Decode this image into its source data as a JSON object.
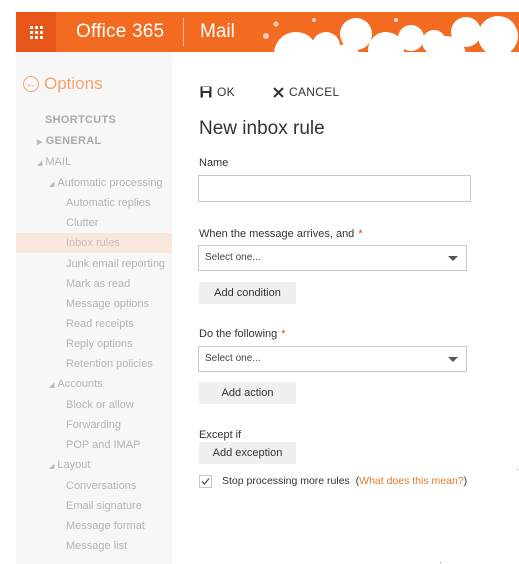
{
  "header": {
    "brand": "Office 365",
    "app": "Mail",
    "colors": {
      "bar": "#f26b21",
      "waffle": "#e8561a"
    }
  },
  "sidebar": {
    "back_label": "Options",
    "items": [
      {
        "label": "SHORTCUTS",
        "type": "section"
      },
      {
        "label": "GENERAL",
        "type": "section"
      },
      {
        "label": "MAIL",
        "type": "section"
      },
      {
        "label": "Automatic processing",
        "type": "group"
      },
      {
        "label": "Automatic replies"
      },
      {
        "label": "Clutter"
      },
      {
        "label": "Inbox rules",
        "active": true
      },
      {
        "label": "Junk email reporting"
      },
      {
        "label": "Mark as read"
      },
      {
        "label": "Message options"
      },
      {
        "label": "Read receipts"
      },
      {
        "label": "Reply options"
      },
      {
        "label": "Retention policies"
      },
      {
        "label": "Accounts",
        "type": "group"
      },
      {
        "label": "Block or allow"
      },
      {
        "label": "Forwarding"
      },
      {
        "label": "POP and IMAP"
      },
      {
        "label": "Layout",
        "type": "group"
      },
      {
        "label": "Conversations"
      },
      {
        "label": "Email signature"
      },
      {
        "label": "Message format"
      },
      {
        "label": "Message list"
      }
    ]
  },
  "commands": {
    "ok": "OK",
    "cancel": "CANCEL"
  },
  "form": {
    "title": "New inbox rule",
    "name_label": "Name",
    "name_value": "",
    "when_label": "When the message arrives, and",
    "when_select": "Select one...",
    "add_condition": "Add condition",
    "do_label": "Do the following",
    "do_select": "Select one...",
    "add_action": "Add action",
    "except_label": "Except if",
    "add_exception": "Add exception",
    "stop_label": "Stop processing more rules",
    "stop_checked": true,
    "help_link": "What does this mean?",
    "required_mark": "*"
  }
}
